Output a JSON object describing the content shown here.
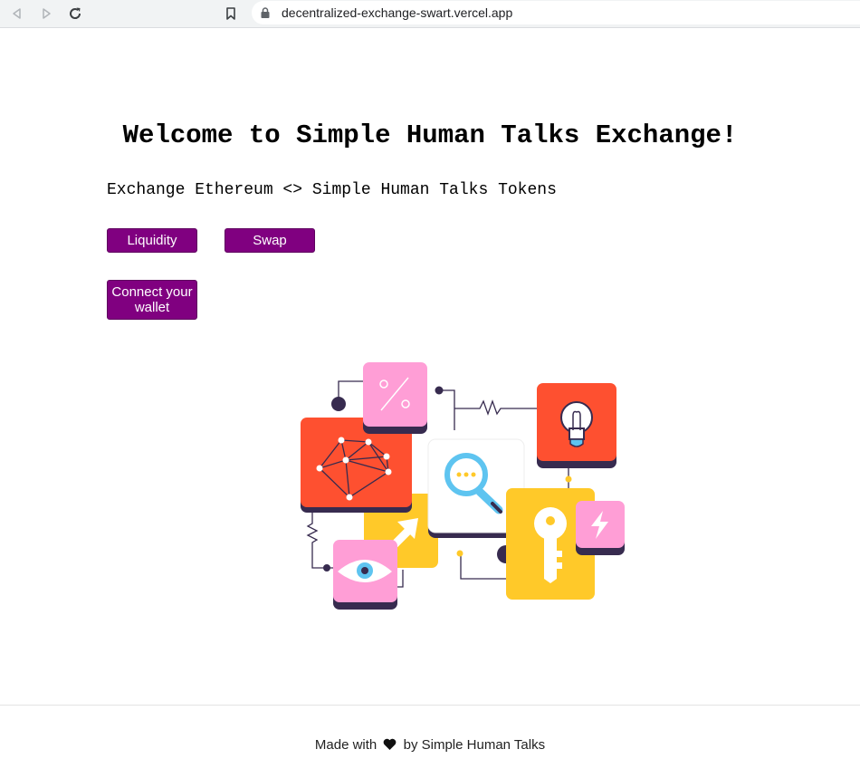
{
  "browser": {
    "url": "decentralized-exchange-swart.vercel.app"
  },
  "main": {
    "title": "Welcome to Simple Human Talks Exchange!",
    "subtitle": "Exchange Ethereum <> Simple Human Talks Tokens",
    "liquidity_label": "Liquidity",
    "swap_label": "Swap",
    "connect_label": "Connect your wallet"
  },
  "footer": {
    "prefix": "Made with",
    "suffix": "by Simple Human Talks",
    "icon": "heart-icon"
  },
  "colors": {
    "button": "#800080",
    "orange": "#fe5030",
    "yellow": "#ffc929",
    "pink": "#ff9ed6",
    "navy": "#372b4f",
    "blue": "#5ec4f0"
  }
}
